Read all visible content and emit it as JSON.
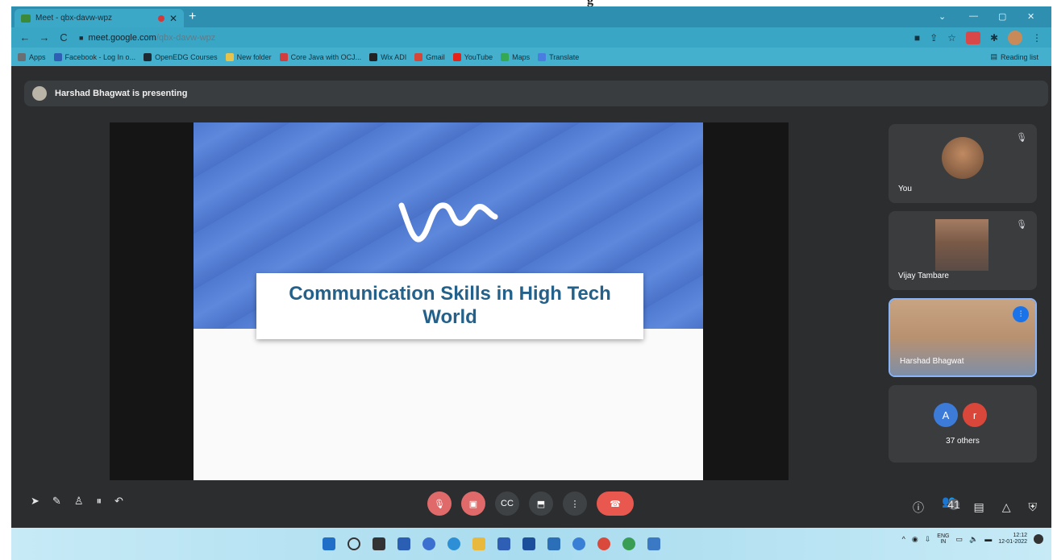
{
  "scan_header": "g",
  "browser": {
    "tab_title": "Meet - qbx-davw-wpz",
    "tab_close": "✕",
    "new_tab": "+",
    "window_controls": [
      "⌄",
      "—",
      "▢",
      "✕"
    ],
    "url_host": "meet.google.com",
    "url_path": "/qbx-davw-wpz",
    "bookmarks": [
      {
        "label": "Apps",
        "color": "#6a6f73"
      },
      {
        "label": "Facebook - Log In o...",
        "color": "#2f5fb4"
      },
      {
        "label": "OpenEDG Courses",
        "color": "#1e2a33"
      },
      {
        "label": "New folder",
        "color": "#e6c34a"
      },
      {
        "label": "Core Java with OCJ...",
        "color": "#d13c3c"
      },
      {
        "label": "Wix ADI",
        "color": "#222"
      },
      {
        "label": "Gmail",
        "color": "#d44638"
      },
      {
        "label": "YouTube",
        "color": "#e62117"
      },
      {
        "label": "Maps",
        "color": "#35a853"
      },
      {
        "label": "Translate",
        "color": "#4a7de0"
      }
    ],
    "reading_list": "Reading list"
  },
  "meet": {
    "presenting_text": "Harshad Bhagwat is presenting",
    "slide_title": "Communication Skills in High Tech World",
    "participants": [
      {
        "name": "You"
      },
      {
        "name": "Vijay Tambare"
      },
      {
        "name": "Harshad Bhagwat"
      }
    ],
    "others": {
      "avatars": [
        {
          "letter": "A",
          "color": "#3d7bd8"
        },
        {
          "letter": "r",
          "color": "#d9473b"
        }
      ],
      "label": "37 others"
    },
    "participant_count": "41"
  },
  "taskbar": {
    "lang_top": "ENG",
    "lang_bottom": "IN",
    "time": "12:12",
    "date": "12-01-2022"
  }
}
